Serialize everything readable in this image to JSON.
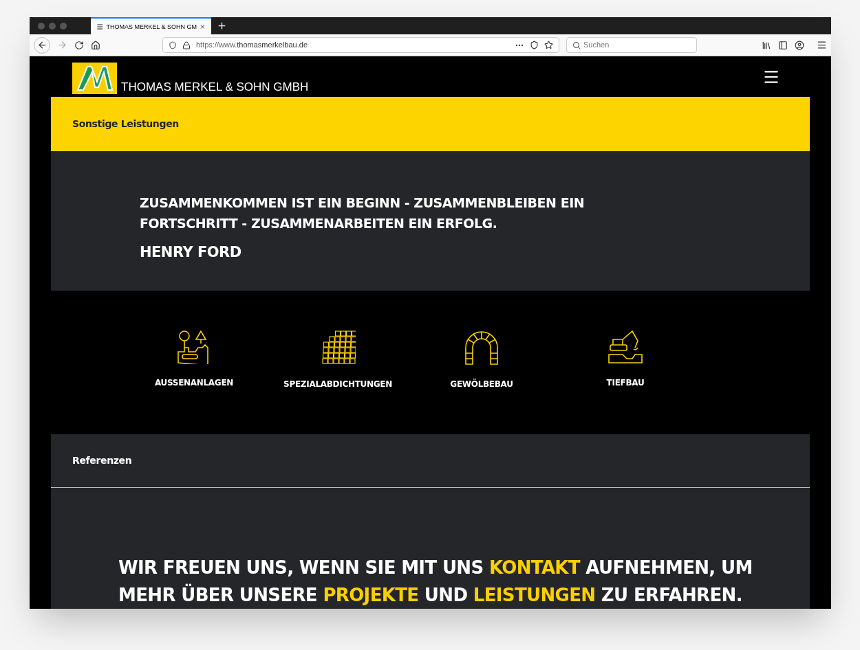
{
  "browser": {
    "tab_title": "THOMAS MERKEL & SOHN GM",
    "url_prefix": "https://www.",
    "url_host": "thomasmerkelbau.de",
    "search_placeholder": "Suchen"
  },
  "header": {
    "company": "THOMAS MERKEL & SOHN GMBH"
  },
  "services_banner": {
    "title": "Sonstige Leistungen"
  },
  "quote": {
    "text": "ZUSAMMENKOMMEN IST EIN BEGINN - ZUSAMMENBLEIBEN EIN FORTSCHRITT - ZUSAMMENARBEITEN EIN ERFOLG.",
    "author": "HENRY FORD"
  },
  "services": [
    {
      "kind": "garden",
      "label": "AUSSENANLAGEN"
    },
    {
      "kind": "tiles",
      "label": "SPEZIALABDICHTUNGEN"
    },
    {
      "kind": "arch",
      "label": "GEWÖLBEBAU"
    },
    {
      "kind": "excavator",
      "label": "TIEFBAU"
    }
  ],
  "references": {
    "title": "Referenzen"
  },
  "contact": {
    "lines": [
      [
        {
          "text": "WIR FREUEN UNS, WENN SIE MIT UNS ",
          "highlight": false
        },
        {
          "text": "KONTAKT",
          "highlight": true
        },
        {
          "text": " AUFNEHMEN, UM",
          "highlight": false
        }
      ],
      [
        {
          "text": "MEHR ÜBER UNSERE ",
          "highlight": false
        },
        {
          "text": "PROJEKTE",
          "highlight": true
        },
        {
          "text": " UND ",
          "highlight": false
        },
        {
          "text": "LEISTUNGEN",
          "highlight": true
        },
        {
          "text": " ZU ERFAHREN.",
          "highlight": false
        }
      ]
    ]
  }
}
